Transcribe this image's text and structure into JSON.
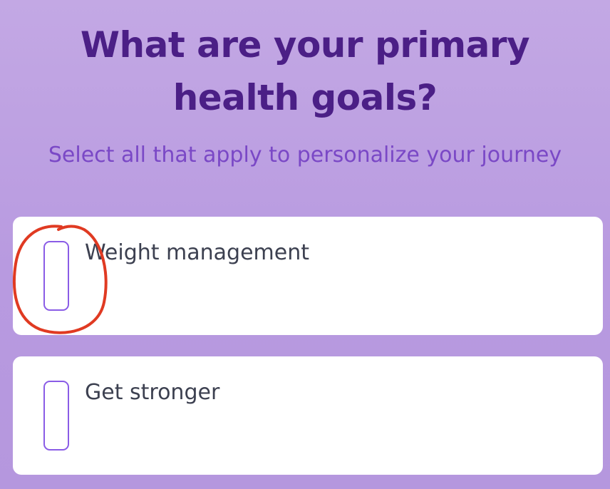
{
  "header": {
    "title_line1": "What are your primary",
    "title_line2": "health goals?",
    "subtitle": "Select all that apply to personalize your journey"
  },
  "options": [
    {
      "label": "Weight management",
      "checked": false
    },
    {
      "label": "Get stronger",
      "checked": false
    }
  ],
  "colors": {
    "background": "#bc9fe2",
    "title": "#4b1f86",
    "subtitle": "#7a48c6",
    "checkbox_border": "#8a5ce6",
    "annotation": "#e03a22"
  }
}
